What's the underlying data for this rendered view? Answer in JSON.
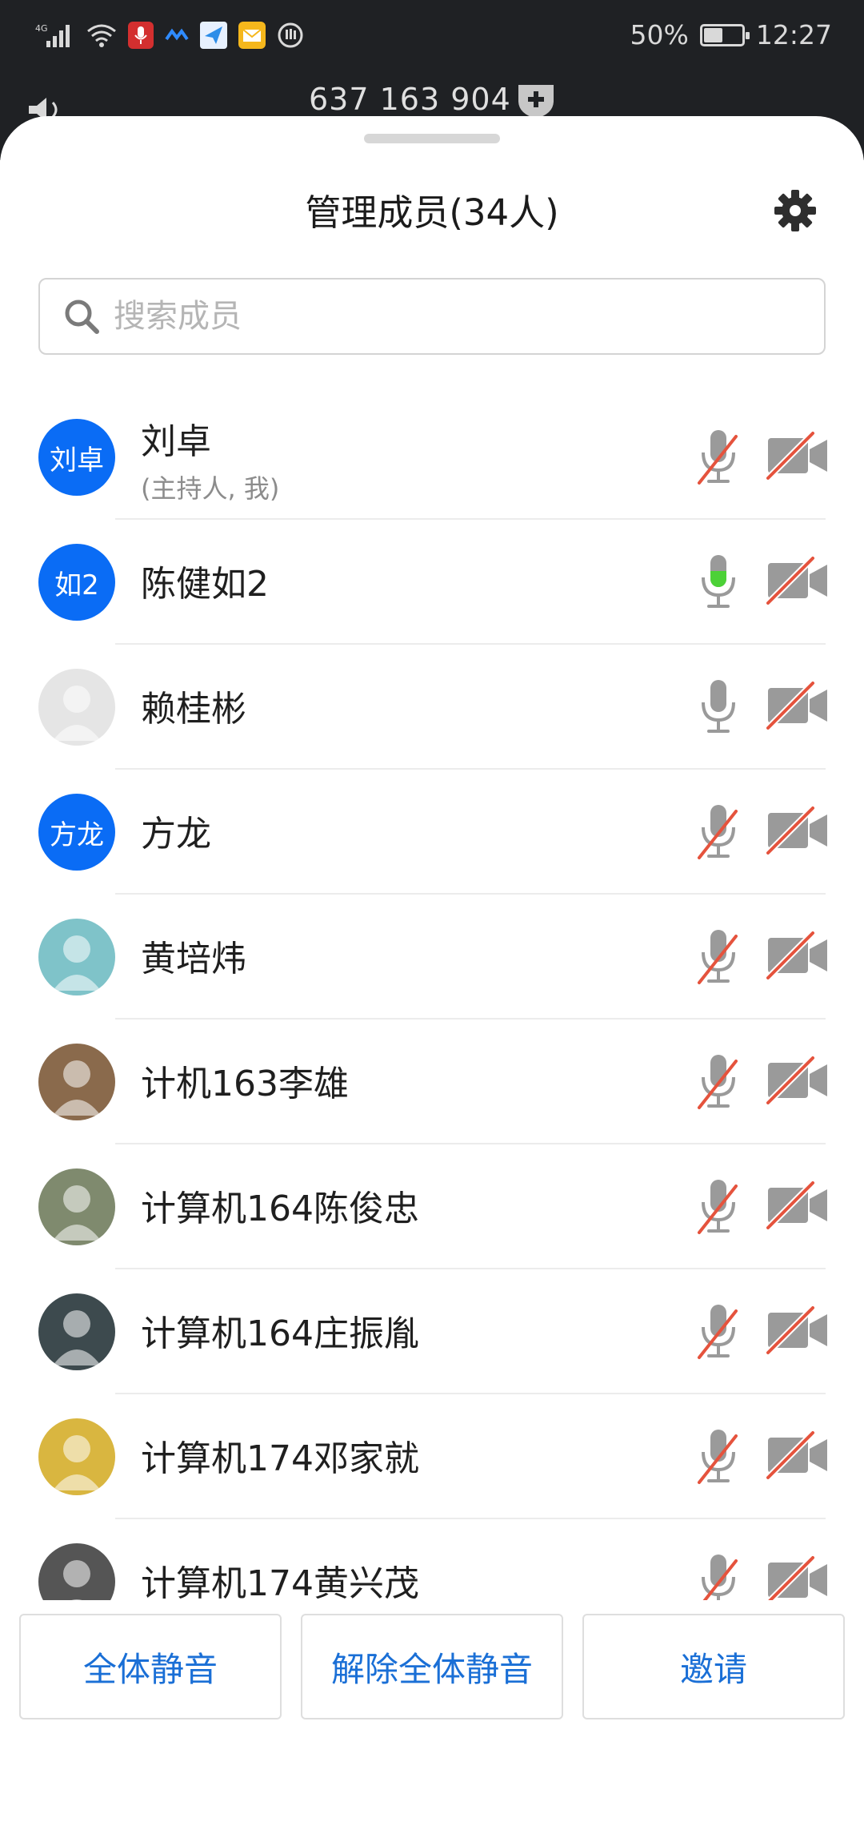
{
  "status_bar": {
    "network_label": "4G",
    "battery_percent_text": "50%",
    "battery_level": 0.5,
    "time": "12:27"
  },
  "meeting": {
    "meeting_id": "637 163 904"
  },
  "sheet": {
    "title": "管理成员(34人)",
    "settings_icon": "gear-icon"
  },
  "search": {
    "placeholder": "搜索成员",
    "value": ""
  },
  "members": [
    {
      "name": "刘卓",
      "sub": "(主持人, 我)",
      "avatar_text": "刘卓",
      "avatar_color": "#0a6cf5",
      "mic": "muted",
      "camera": "off"
    },
    {
      "name": "陈健如2",
      "sub": "",
      "avatar_text": "如2",
      "avatar_color": "#0a6cf5",
      "mic": "active",
      "camera": "off"
    },
    {
      "name": "赖桂彬",
      "sub": "",
      "avatar_text": "",
      "avatar_color": "#e5e5e5",
      "mic": "on",
      "camera": "off"
    },
    {
      "name": "方龙",
      "sub": "",
      "avatar_text": "方龙",
      "avatar_color": "#0a6cf5",
      "mic": "muted",
      "camera": "off"
    },
    {
      "name": "黄培炜",
      "sub": "",
      "avatar_text": "",
      "avatar_color": "#7fc3c9",
      "mic": "muted",
      "camera": "off"
    },
    {
      "name": "计机163李雄",
      "sub": "",
      "avatar_text": "",
      "avatar_color": "#8a6a4c",
      "mic": "muted",
      "camera": "off"
    },
    {
      "name": "计算机164陈俊忠",
      "sub": "",
      "avatar_text": "",
      "avatar_color": "#7f8a6e",
      "mic": "muted",
      "camera": "off"
    },
    {
      "name": "计算机164庄振胤",
      "sub": "",
      "avatar_text": "",
      "avatar_color": "#3d4a4e",
      "mic": "muted",
      "camera": "off"
    },
    {
      "name": "计算机174邓家就",
      "sub": "",
      "avatar_text": "",
      "avatar_color": "#d9b640",
      "mic": "muted",
      "camera": "off"
    },
    {
      "name": "计算机174黄兴茂",
      "sub": "",
      "avatar_text": "",
      "avatar_color": "#555555",
      "mic": "muted",
      "camera": "off"
    }
  ],
  "actions": {
    "mute_all": "全体静音",
    "unmute_all": "解除全体静音",
    "invite": "邀请"
  },
  "colors": {
    "accent": "#1a6fd6",
    "avatar_blue": "#0a6cf5",
    "muted_slash": "#e5533d",
    "mic_active": "#4cd137",
    "icon_gray": "#9a9a9a"
  }
}
